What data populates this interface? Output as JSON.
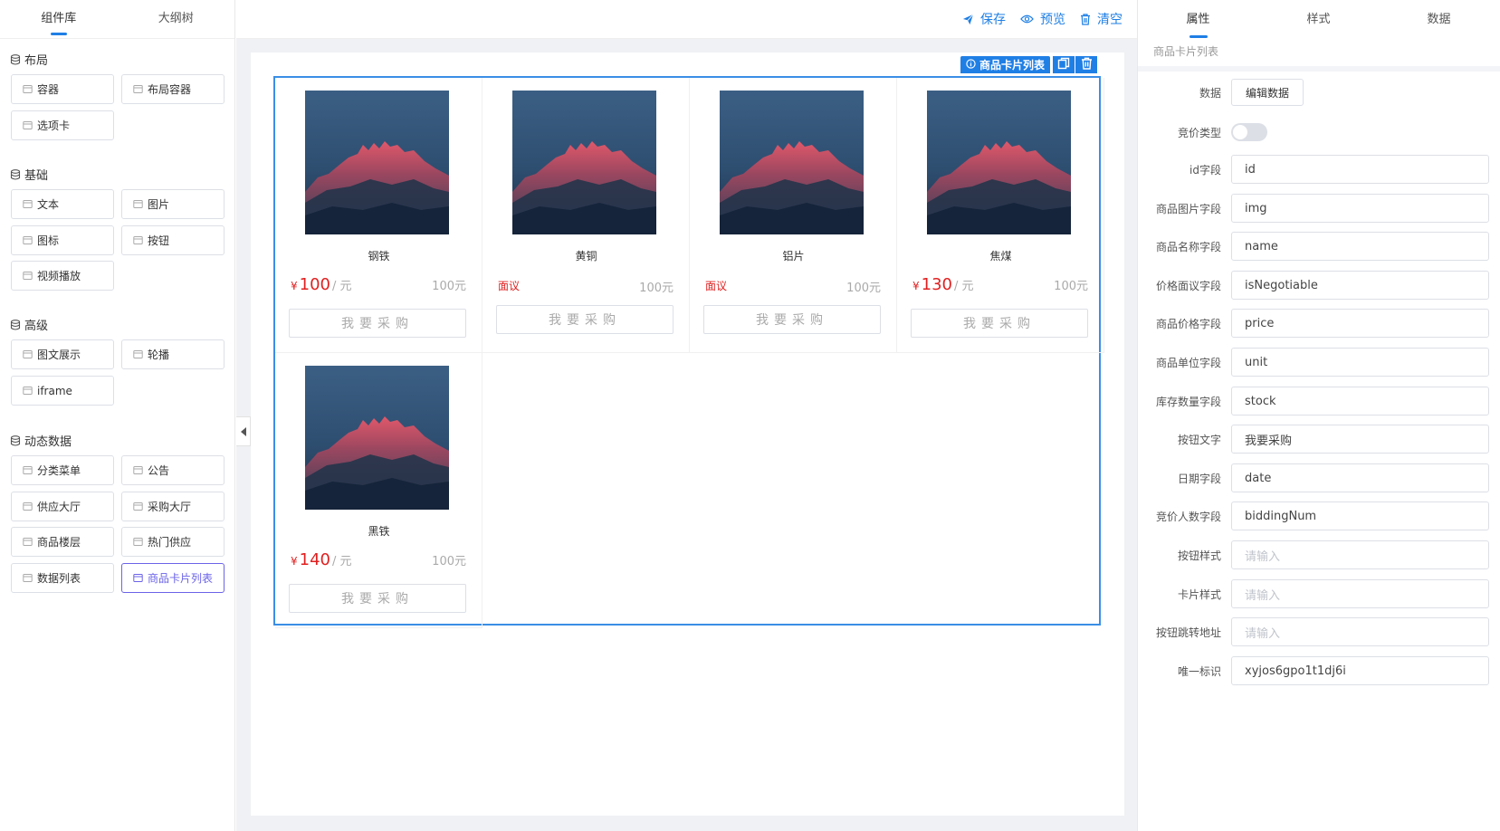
{
  "left_tabs": [
    "组件库",
    "大纲树"
  ],
  "groups": [
    {
      "title": "布局",
      "items": [
        {
          "label": "容器",
          "icon": "container-icon"
        },
        {
          "label": "布局容器",
          "icon": "layout-container-icon"
        },
        {
          "label": "选项卡",
          "icon": "tabs-icon"
        }
      ]
    },
    {
      "title": "基础",
      "items": [
        {
          "label": "文本",
          "icon": "text-icon"
        },
        {
          "label": "图片",
          "icon": "image-icon"
        },
        {
          "label": "图标",
          "icon": "icon-icon"
        },
        {
          "label": "按钮",
          "icon": "button-icon"
        },
        {
          "label": "视频播放",
          "icon": "video-icon"
        }
      ]
    },
    {
      "title": "高级",
      "items": [
        {
          "label": "图文展示",
          "icon": "image-text-icon"
        },
        {
          "label": "轮播",
          "icon": "carousel-icon"
        },
        {
          "label": "iframe",
          "icon": "iframe-icon"
        }
      ]
    },
    {
      "title": "动态数据",
      "items": [
        {
          "label": "分类菜单",
          "icon": "category-menu-icon"
        },
        {
          "label": "公告",
          "icon": "notice-icon"
        },
        {
          "label": "供应大厅",
          "icon": "supply-hall-icon"
        },
        {
          "label": "采购大厅",
          "icon": "purchase-hall-icon"
        },
        {
          "label": "商品楼层",
          "icon": "product-floor-icon"
        },
        {
          "label": "热门供应",
          "icon": "hot-supply-icon"
        },
        {
          "label": "数据列表",
          "icon": "data-list-icon"
        },
        {
          "label": "商品卡片列表",
          "icon": "product-card-list-icon"
        }
      ]
    }
  ],
  "toolbar": {
    "save": "保存",
    "preview": "预览",
    "clear": "清空"
  },
  "selection": {
    "label": "商品卡片列表"
  },
  "products": [
    {
      "name": "钢铁",
      "negotiable": false,
      "yen": "¥",
      "price": "100",
      "unit": "/ 元",
      "stock": "100元",
      "button": "我要采购"
    },
    {
      "name": "黄铜",
      "negotiable": true,
      "nego_text": "面议",
      "stock": "100元",
      "button": "我要采购"
    },
    {
      "name": "铝片",
      "negotiable": true,
      "nego_text": "面议",
      "stock": "100元",
      "button": "我要采购"
    },
    {
      "name": "焦煤",
      "negotiable": false,
      "yen": "¥",
      "price": "130",
      "unit": "/ 元",
      "stock": "100元",
      "button": "我要采购"
    },
    {
      "name": "黑铁",
      "negotiable": false,
      "yen": "¥",
      "price": "140",
      "unit": "/ 元",
      "stock": "100元",
      "button": "我要采购"
    }
  ],
  "right_tabs": [
    "属性",
    "样式",
    "数据"
  ],
  "right_subtitle": "商品卡片列表",
  "props": {
    "data_label": "数据",
    "data_button": "编辑数据",
    "bidding_label": "竞价类型",
    "bidding_on": false,
    "fields": [
      {
        "label": "id字段",
        "value": "id",
        "placeholder": false
      },
      {
        "label": "商品图片字段",
        "value": "img",
        "placeholder": false
      },
      {
        "label": "商品名称字段",
        "value": "name",
        "placeholder": false
      },
      {
        "label": "价格面议字段",
        "value": "isNegotiable",
        "placeholder": false
      },
      {
        "label": "商品价格字段",
        "value": "price",
        "placeholder": false
      },
      {
        "label": "商品单位字段",
        "value": "unit",
        "placeholder": false
      },
      {
        "label": "库存数量字段",
        "value": "stock",
        "placeholder": false
      },
      {
        "label": "按钮文字",
        "value": "我要采购",
        "placeholder": false
      },
      {
        "label": "日期字段",
        "value": "date",
        "placeholder": false
      },
      {
        "label": "竞价人数字段",
        "value": "biddingNum",
        "placeholder": false
      },
      {
        "label": "按钮样式",
        "value": "请输入",
        "placeholder": true
      },
      {
        "label": "卡片样式",
        "value": "请输入",
        "placeholder": true
      },
      {
        "label": "按钮跳转地址",
        "value": "请输入",
        "placeholder": true
      },
      {
        "label": "唯一标识",
        "value": "xyjos6gpo1t1dj6i",
        "placeholder": false
      }
    ]
  },
  "colors": {
    "accent": "#1f7fe5",
    "price_red": "#e02020",
    "active_purple": "#6b63e8"
  }
}
